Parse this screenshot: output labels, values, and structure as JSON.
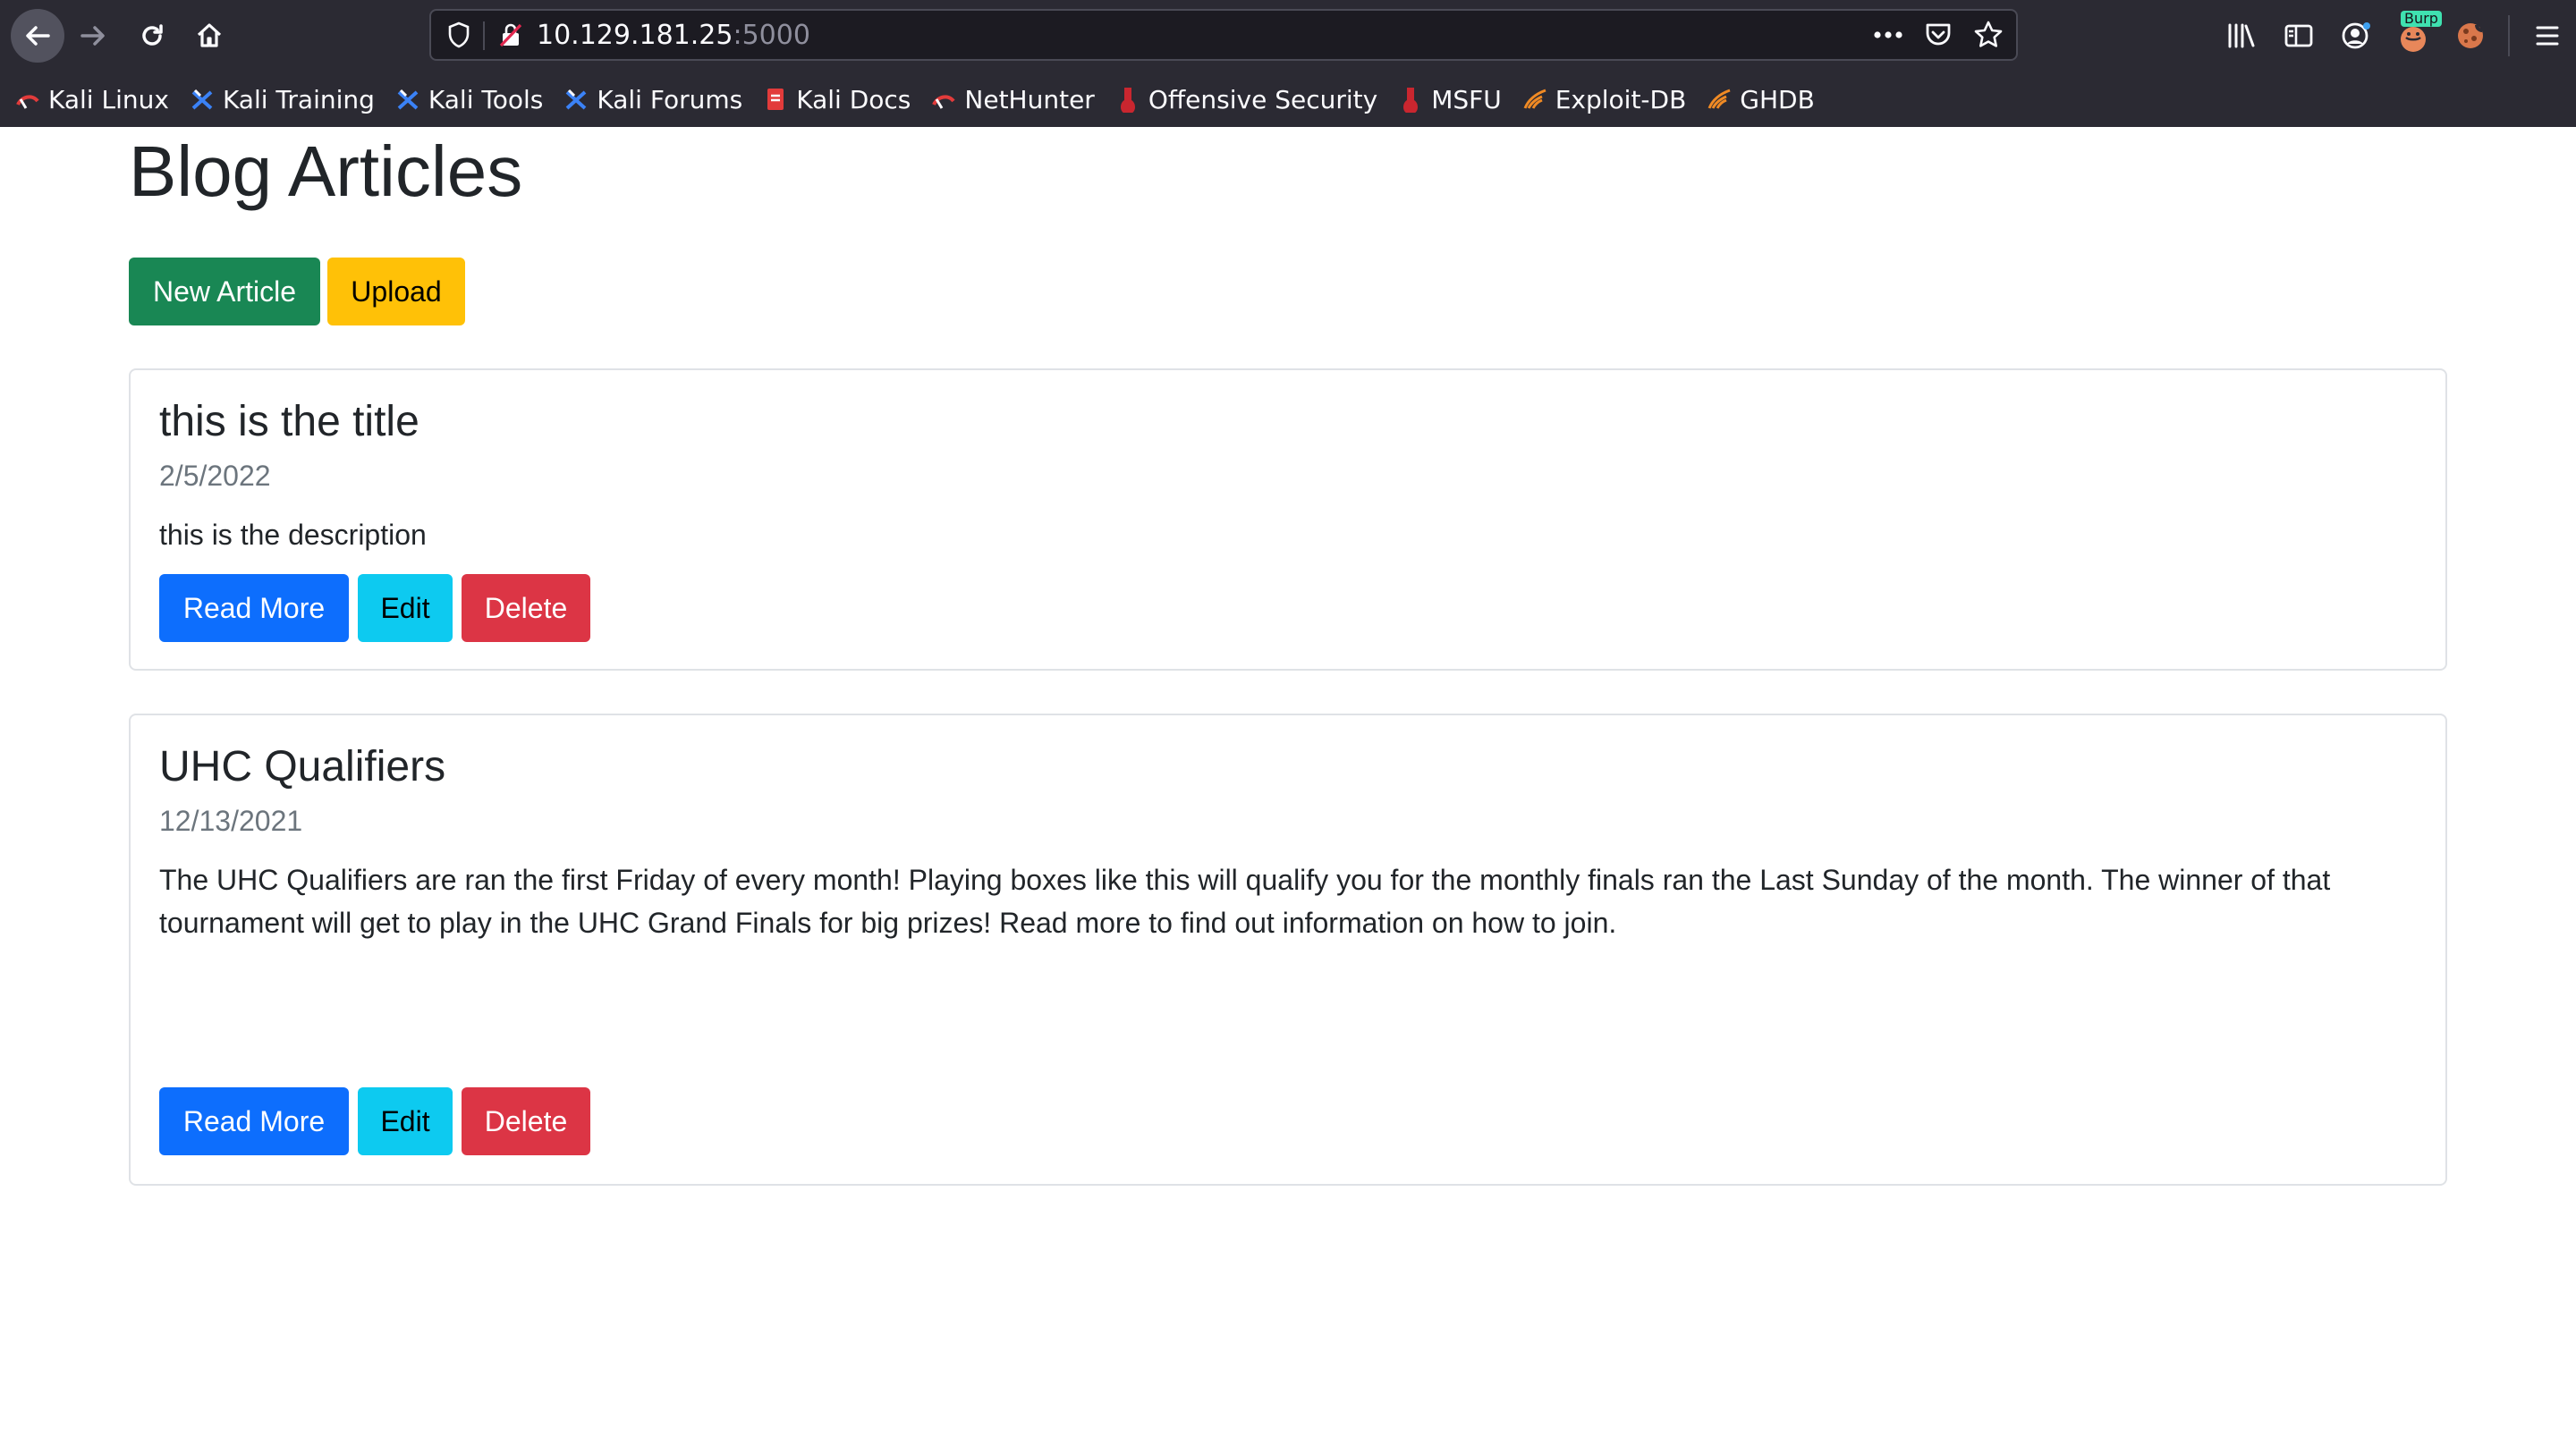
{
  "browser": {
    "url_host": "10.129.181.25",
    "url_port": ":5000",
    "burp_label": "Burp",
    "bookmarks": [
      {
        "label": "Kali Linux",
        "icon": "kali-dragon-icon"
      },
      {
        "label": "Kali Training",
        "icon": "kali-tools-icon"
      },
      {
        "label": "Kali Tools",
        "icon": "kali-tools-icon"
      },
      {
        "label": "Kali Forums",
        "icon": "kali-tools-icon"
      },
      {
        "label": "Kali Docs",
        "icon": "kali-docs-icon"
      },
      {
        "label": "NetHunter",
        "icon": "kali-dragon-icon"
      },
      {
        "label": "Offensive Security",
        "icon": "offsec-icon"
      },
      {
        "label": "MSFU",
        "icon": "offsec-icon"
      },
      {
        "label": "Exploit-DB",
        "icon": "exploit-db-icon"
      },
      {
        "label": "GHDB",
        "icon": "exploit-db-icon"
      }
    ]
  },
  "page": {
    "title": "Blog Articles",
    "new_article_label": "New Article",
    "upload_label": "Upload"
  },
  "articles": [
    {
      "title": "this is the title",
      "date": "2/5/2022",
      "description": "this is the description",
      "read_more_label": "Read More",
      "edit_label": "Edit",
      "delete_label": "Delete"
    },
    {
      "title": "UHC Qualifiers",
      "date": "12/13/2021",
      "description": "The UHC Qualifiers are ran the first Friday of every month! Playing boxes like this will qualify you for the monthly finals ran the Last Sunday of the month. The winner of that tournament will get to play in the UHC Grand Finals for big prizes! Read more to find out information on how to join.",
      "read_more_label": "Read More",
      "edit_label": "Edit",
      "delete_label": "Delete"
    }
  ],
  "colors": {
    "success": "#198754",
    "warning": "#ffc107",
    "primary": "#0d6efd",
    "info": "#0dcaf0",
    "danger": "#dc3545",
    "chrome": "#2b2a33"
  }
}
